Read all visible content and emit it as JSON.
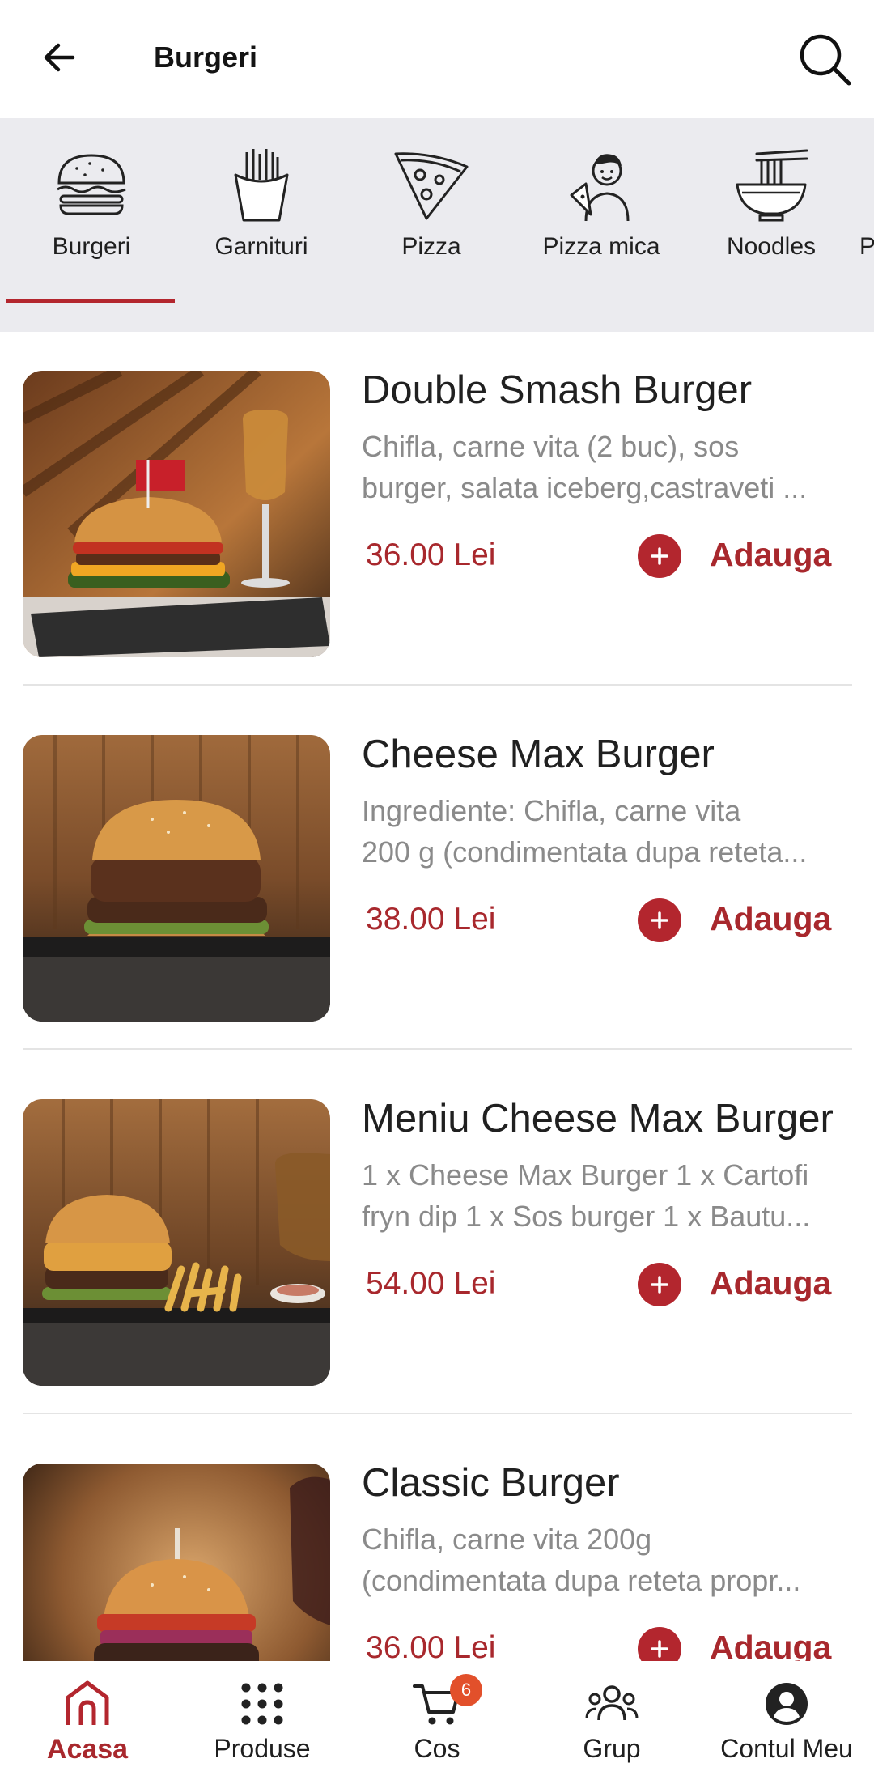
{
  "header": {
    "title": "Burgeri",
    "back_icon": "arrow-left-icon",
    "search_icon": "search-icon"
  },
  "categories": [
    {
      "label": "Burgeri",
      "icon": "burger-icon",
      "selected": true
    },
    {
      "label": "Garnituri",
      "icon": "fries-icon",
      "selected": false
    },
    {
      "label": "Pizza",
      "icon": "pizza-slice-icon",
      "selected": false
    },
    {
      "label": "Pizza mica",
      "icon": "kid-pizza-icon",
      "selected": false
    },
    {
      "label": "Noodles",
      "icon": "noodles-icon",
      "selected": false
    },
    {
      "label": "P",
      "icon": "",
      "selected": false
    }
  ],
  "products": [
    {
      "name": "Double Smash Burger",
      "desc_line1": "Chifla, carne vita (2 buc), sos",
      "desc_line2": "burger, salata iceberg,castraveti ...",
      "price": "36.00 Lei",
      "add_label": "Adauga"
    },
    {
      "name": "Cheese Max Burger",
      "desc_line1": "Ingrediente: Chifla, carne vita",
      "desc_line2": "200 g (condimentata dupa reteta...",
      "price": "38.00 Lei",
      "add_label": "Adauga"
    },
    {
      "name": "Meniu Cheese Max Burger",
      "desc_line1": "  1 x Cheese Max Burger 1 x Cartofi",
      "desc_line2": "fryn dip 1 x Sos burger 1 x Bautu...",
      "price": "54.00 Lei",
      "add_label": "Adauga"
    },
    {
      "name": "Classic Burger",
      "desc_line1": "  Chifla, carne vita 200g",
      "desc_line2": "(condimentata dupa reteta propr...",
      "price": "36.00 Lei",
      "add_label": "Adauga"
    }
  ],
  "nav": [
    {
      "label": "Acasa",
      "icon": "home-icon",
      "active": true
    },
    {
      "label": "Produse",
      "icon": "grid-icon",
      "active": false
    },
    {
      "label": "Cos",
      "icon": "cart-icon",
      "active": false,
      "badge": "6"
    },
    {
      "label": "Grup",
      "icon": "group-icon",
      "active": false
    },
    {
      "label": "Contul Meu",
      "icon": "account-icon",
      "active": false
    }
  ],
  "colors": {
    "accent": "#b3262e",
    "price": "#a8282d",
    "category_bg": "#ebebef",
    "badge": "#e2502b"
  }
}
